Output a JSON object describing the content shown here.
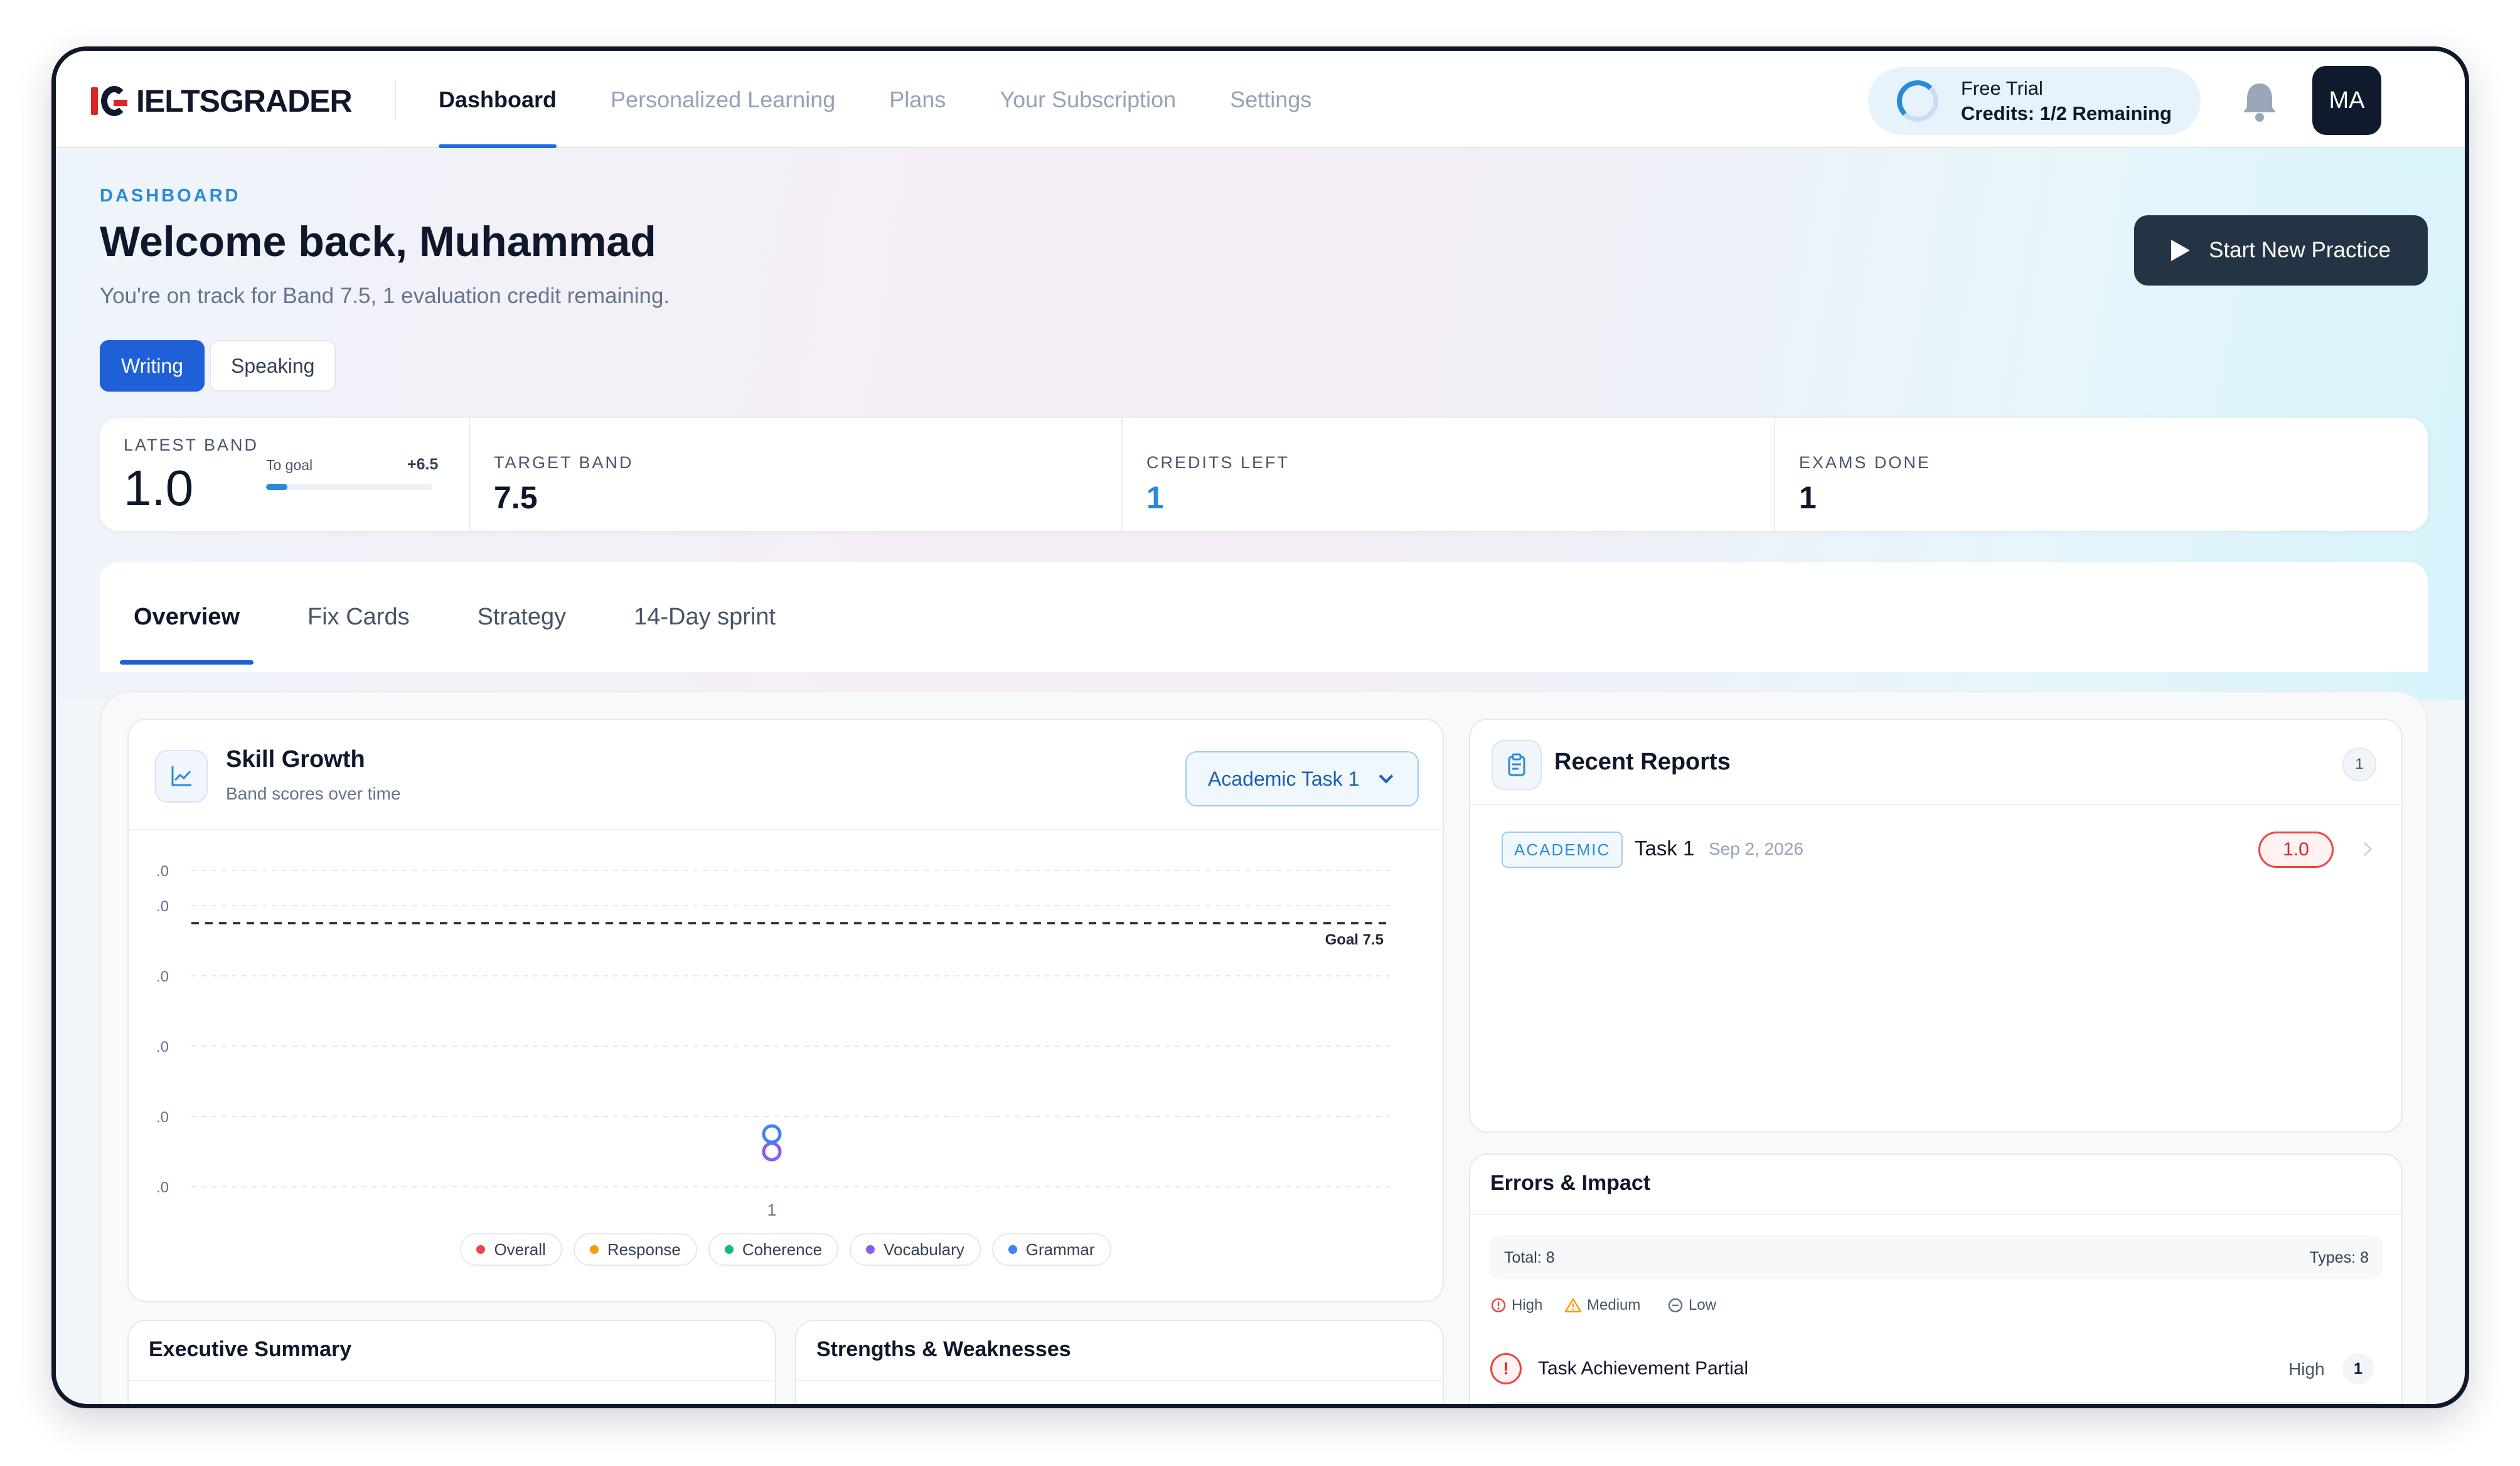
{
  "app": {
    "logo_text": "IELTSGRADER"
  },
  "nav": {
    "items": [
      {
        "label": "Dashboard",
        "active": true
      },
      {
        "label": "Personalized Learning",
        "active": false
      },
      {
        "label": "Plans",
        "active": false
      },
      {
        "label": "Your Subscription",
        "active": false
      },
      {
        "label": "Settings",
        "active": false
      }
    ]
  },
  "trial": {
    "line1": "Free Trial",
    "line2": "Credits: 1/2 Remaining"
  },
  "user": {
    "initials": "MA"
  },
  "hero": {
    "eyebrow": "DASHBOARD",
    "title": "Welcome back, Muhammad",
    "subtitle": "You're on track for Band 7.5, 1 evaluation credit remaining.",
    "start_button": "Start New Practice"
  },
  "mode_toggle": {
    "writing": "Writing",
    "speaking": "Speaking",
    "selected": "Writing"
  },
  "stats": {
    "latest_band": {
      "label": "LATEST BAND",
      "value": "1.0",
      "goal_label": "To goal",
      "goal_delta": "+6.5",
      "goal_progress": 0.13
    },
    "target_band": {
      "label": "TARGET BAND",
      "value": "7.5"
    },
    "credits_left": {
      "label": "CREDITS LEFT",
      "value": "1"
    },
    "exams_done": {
      "label": "EXAMS DONE",
      "value": "1"
    }
  },
  "tabs": {
    "items": [
      {
        "label": "Overview",
        "active": true
      },
      {
        "label": "Fix Cards",
        "active": false
      },
      {
        "label": "Strategy",
        "active": false
      },
      {
        "label": "14-Day sprint",
        "active": false
      }
    ]
  },
  "skill_growth": {
    "title": "Skill Growth",
    "subtitle": "Band scores over time",
    "selector": "Academic Task 1",
    "goal_label": "Goal 7.5"
  },
  "chart_data": {
    "type": "line",
    "x": [
      "1"
    ],
    "ylim": [
      0,
      9
    ],
    "y_ticks": [
      0,
      2,
      4,
      6,
      8,
      9
    ],
    "y_tick_labels": [
      ".0",
      ".0",
      ".0",
      ".0",
      ".0",
      ".0"
    ],
    "goal": 7.5,
    "grid": true,
    "legend_position": "bottom",
    "series": [
      {
        "name": "Overall",
        "color": "#ef4444",
        "values": [
          1.0
        ]
      },
      {
        "name": "Response",
        "color": "#f59e0b",
        "values": [
          1.0
        ]
      },
      {
        "name": "Coherence",
        "color": "#10b981",
        "values": [
          1.0
        ]
      },
      {
        "name": "Vocabulary",
        "color": "#8b5cf6",
        "values": [
          1.0
        ]
      },
      {
        "name": "Grammar",
        "color": "#3b82f6",
        "values": [
          1.5
        ]
      }
    ]
  },
  "recent_reports": {
    "title": "Recent Reports",
    "count": "1",
    "items": [
      {
        "type": "ACADEMIC",
        "task": "Task 1",
        "date": "Sep 2, 2026",
        "score": "1.0"
      }
    ]
  },
  "errors": {
    "title": "Errors & Impact",
    "total_label": "Total: 8",
    "types_label": "Types: 8",
    "legend": {
      "high": "High",
      "medium": "Medium",
      "low": "Low"
    },
    "items": [
      {
        "name": "Task Achievement Partial",
        "severity": "High",
        "count": "1"
      }
    ]
  },
  "executive_summary": {
    "title": "Executive Summary"
  },
  "strengths": {
    "title": "Strengths & Weaknesses"
  },
  "colors": {
    "accent": "#1f5fd8",
    "brand_red": "#dc2626",
    "dark": "#0f172a"
  }
}
